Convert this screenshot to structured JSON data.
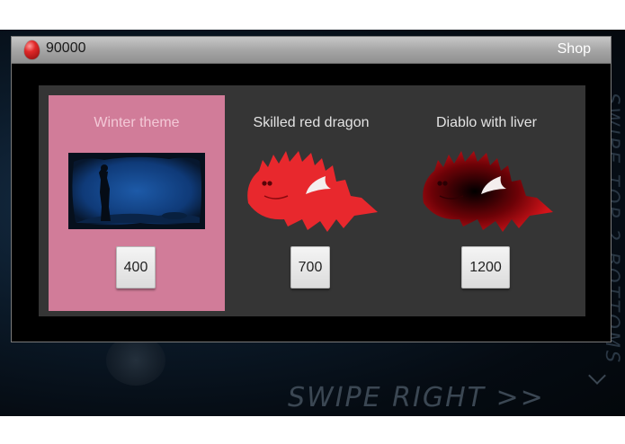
{
  "header": {
    "coins": "90000",
    "title": "Shop",
    "currency_icon": "red-egg-icon"
  },
  "items": [
    {
      "title": "Winter theme",
      "price": "400",
      "selected": true,
      "image": "winter-scene"
    },
    {
      "title": "Skilled red dragon",
      "price": "700",
      "selected": false,
      "image": "red-dragon"
    },
    {
      "title": "Diablo with liver",
      "price": "1200",
      "selected": false,
      "image": "dark-red-dragon"
    }
  ],
  "background": {
    "swipe_hint": "SWIPE RIGHT >>",
    "side_hint": "SWIPE TOP 2 BOTTOMS"
  },
  "colors": {
    "selected_card": "#d17c99",
    "panel": "#353535",
    "dragon_red": "#e8282d",
    "dragon_dark": "#b00d12"
  }
}
